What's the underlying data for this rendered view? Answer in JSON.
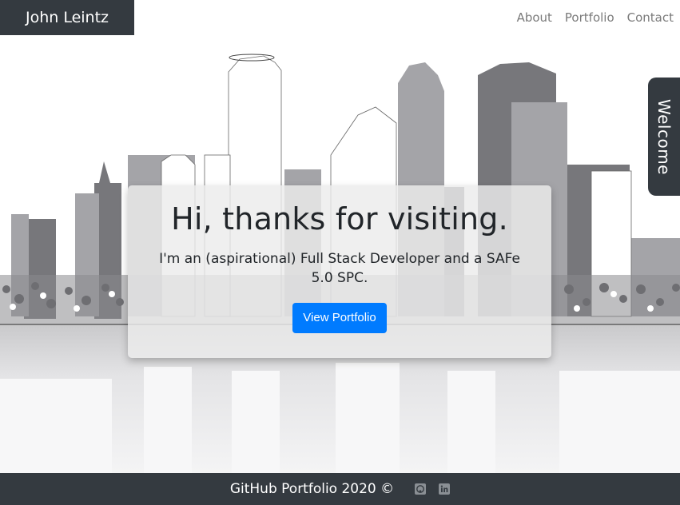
{
  "navbar": {
    "brand": "John Leintz",
    "links": [
      "About",
      "Portfolio",
      "Contact"
    ]
  },
  "welcome_tab": {
    "label": "Welcome"
  },
  "hero": {
    "heading": "Hi, thanks for visiting.",
    "subheading": "I'm an (aspirational) Full Stack Developer and a SAFe 5.0 SPC.",
    "button_label": "View Portfolio"
  },
  "footer": {
    "text": "GitHub Portfolio 2020 ©",
    "icons": [
      "github-icon",
      "linkedin-icon"
    ]
  },
  "colors": {
    "dark": "#343a40",
    "primary": "#007bff",
    "nav_link": "#7a7a7a"
  }
}
